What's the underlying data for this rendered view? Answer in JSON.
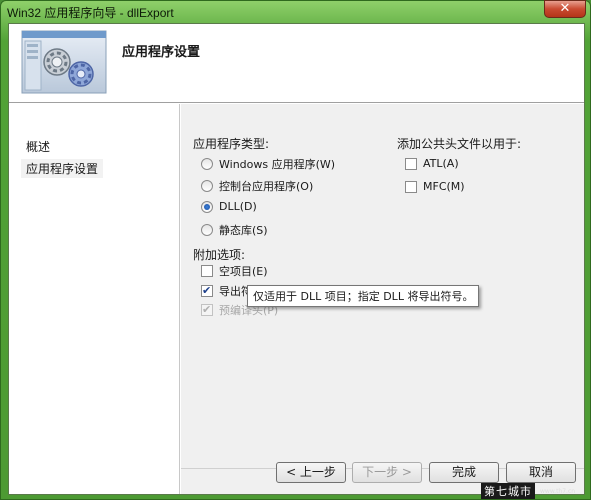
{
  "window": {
    "title": "Win32 应用程序向导 - dllExport",
    "close_glyph": "✕"
  },
  "header": {
    "title": "应用程序设置"
  },
  "nav": {
    "items": [
      {
        "label": "概述"
      },
      {
        "label": "应用程序设置"
      }
    ]
  },
  "app_type": {
    "label": "应用程序类型:",
    "options": [
      {
        "label": "Windows 应用程序(W)",
        "checked": false
      },
      {
        "label": "控制台应用程序(O)",
        "checked": false
      },
      {
        "label": "DLL(D)",
        "checked": true
      },
      {
        "label": "静态库(S)",
        "checked": false
      }
    ]
  },
  "common_headers": {
    "label": "添加公共头文件以用于:",
    "options": [
      {
        "label": "ATL(A)",
        "checked": false
      },
      {
        "label": "MFC(M)",
        "checked": false
      }
    ]
  },
  "extra_options": {
    "label": "附加选项:",
    "options": [
      {
        "label": "空项目(E)",
        "checked": false,
        "enabled": true
      },
      {
        "label": "导出符号(X)",
        "checked": true,
        "enabled": true
      },
      {
        "label": "预编译头(P)",
        "checked": true,
        "enabled": false
      }
    ]
  },
  "tooltip": {
    "text": "仅适用于 DLL 项目；指定 DLL 将导出符号。"
  },
  "buttons": {
    "prev": "< 上一步",
    "next": "下一步 >",
    "finish": "完成",
    "cancel": "取消"
  },
  "watermark": {
    "text": "第七城市",
    "url": "www.th7.cn"
  },
  "colors": {
    "frame": "#52a337",
    "close": "#c94a30",
    "panel": "#f0f0f0"
  }
}
